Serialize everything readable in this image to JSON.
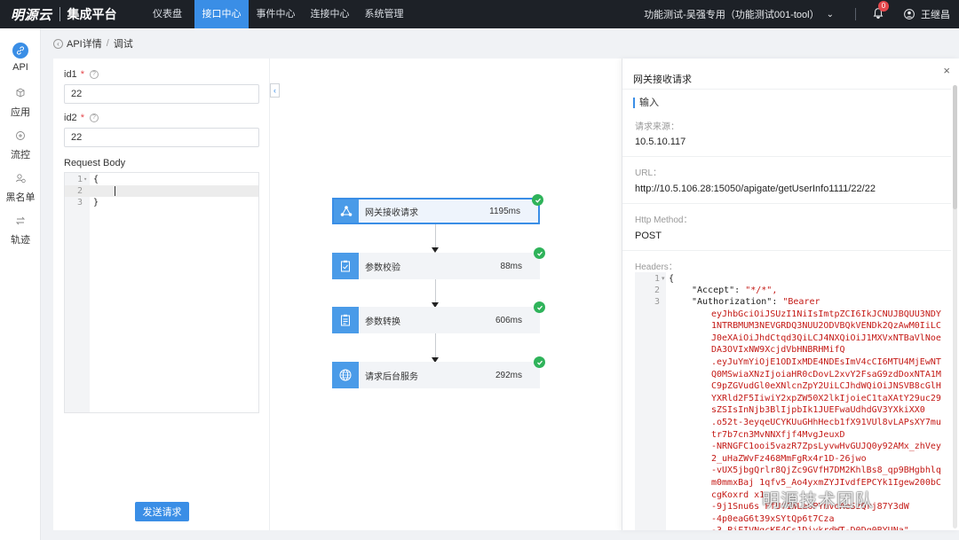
{
  "app": {
    "brand": "明源云",
    "product": "集成平台"
  },
  "nav": {
    "items": [
      {
        "label": "仪表盘",
        "active": false
      },
      {
        "label": "接口中心",
        "active": true
      },
      {
        "label": "事件中心",
        "active": false
      },
      {
        "label": "连接中心",
        "active": false
      },
      {
        "label": "系统管理",
        "active": false
      }
    ],
    "project": "功能测试-吴强专用（功能测试001-tool）",
    "notification_count": "0",
    "user": "王继昌"
  },
  "sidebar": {
    "items": [
      {
        "label": "API",
        "icon": "link-icon",
        "active": true
      },
      {
        "label": "应用",
        "icon": "cube-icon",
        "active": false
      },
      {
        "label": "流控",
        "icon": "plus-circle-icon",
        "active": false
      },
      {
        "label": "黑名单",
        "icon": "user-block-icon",
        "active": false
      },
      {
        "label": "轨迹",
        "icon": "swap-icon",
        "active": false
      }
    ]
  },
  "breadcrumb": {
    "parent": "API详情",
    "current": "调试"
  },
  "form": {
    "fields": [
      {
        "label": "id1",
        "required": "*",
        "value": "22"
      },
      {
        "label": "id2",
        "required": "*",
        "value": "22"
      }
    ],
    "body_label": "Request Body",
    "body_lines": [
      {
        "no": "1",
        "code": "{"
      },
      {
        "no": "2",
        "code": ""
      },
      {
        "no": "3",
        "code": "}"
      }
    ],
    "send_label": "发送请求"
  },
  "flow": {
    "nodes": [
      {
        "name": "网关接收请求",
        "time": "1195ms",
        "icon": "gateway-icon",
        "selected": true
      },
      {
        "name": "参数校验",
        "time": "88ms",
        "icon": "clipboard-check-icon",
        "selected": false
      },
      {
        "name": "参数转换",
        "time": "606ms",
        "icon": "clipboard-edit-icon",
        "selected": false
      },
      {
        "name": "请求后台服务",
        "time": "292ms",
        "icon": "globe-icon",
        "selected": false
      }
    ]
  },
  "drawer": {
    "title": "网关接收请求",
    "section": "输入",
    "source_label": "请求来源：",
    "source_value": "10.5.10.117",
    "url_label": "URL：",
    "url_value": "http://10.5.106.28:15050/apigate/getUserInfo1111/22/22",
    "method_label": "Http Method：",
    "method_value": "POST",
    "headers_label": "Headers：",
    "headers": {
      "line1": "{",
      "accept_key": "\"Accept\"",
      "accept_value": "\"*/*\",",
      "auth_key": "\"Authorization\"",
      "auth_lines": [
        "\"Bearer",
        "eyJhbGciOiJSUzI1NiIsImtpZCI6IkJCNUJBQUU3NDY",
        "1NTRBMUM3NEVGRDQ3NUU2ODVBQkVENDk2QzAwM0IiLC",
        "J0eXAiOiJhdCtqd3QiLCJ4NXQiOiJ1MXVxNTBaVlNoe",
        "DA3OVIxNW9XcjdVbHNBRHMifQ",
        ".eyJuYmYiOjE1ODIxMDE4NDEsImV4cCI6MTU4MjEwNT",
        "Q0MSwiaXNzIjoiaHR0cDovL2xvY2FsaG9zdDoxNTA1M",
        "C9pZGVudGl0eXNlcnZpY2UiLCJhdWQiOiJNSVB8cGlH",
        "YXRld2F5IiwiY2xpZW50X2lkIjoieC1taXAtY29uc29",
        "sZSIsInNjb3BlIjpbIk1JUEFwaUdhdGV3YXkiXX0",
        ".o52t-3eyqeUCYKUuGHhHecb1fX91VUl8vLAPsXY7mu",
        "tr7b7cn3MvNNXfjf4MvgJeuxD",
        "-NRNGFC1ooi5vazR7ZpsLyvwHvGUJQ0y92AMx_zhVey",
        "2_uHaZWvFz468MmFgRx4r1D-26jwo",
        "-vUX5jbgQrlr8QjZc9GVfH7DM2KhlBs8_qp9BHgbhlq",
        "m0mmxBaj 1qfv5_Ao4yxmZYJIvdfEPCYk1Igew200bC",
        "cgKoxrd x1",
        "-9j1Snu6s FfUf1WLa6PYmvoAeSzQrj87Y3dW",
        "-4p0eaG6t39xSYtQp6t7Cza",
        "-3_PiFIVNqcKE4Cs1DiykrdWT-D0Dq0BYUNa\""
      ]
    }
  },
  "watermark": "明源技术团队",
  "colors": {
    "primary": "#3a8ee6",
    "nav_bg": "#1d2127",
    "success": "#2fb35a",
    "string": "#c41a16"
  }
}
